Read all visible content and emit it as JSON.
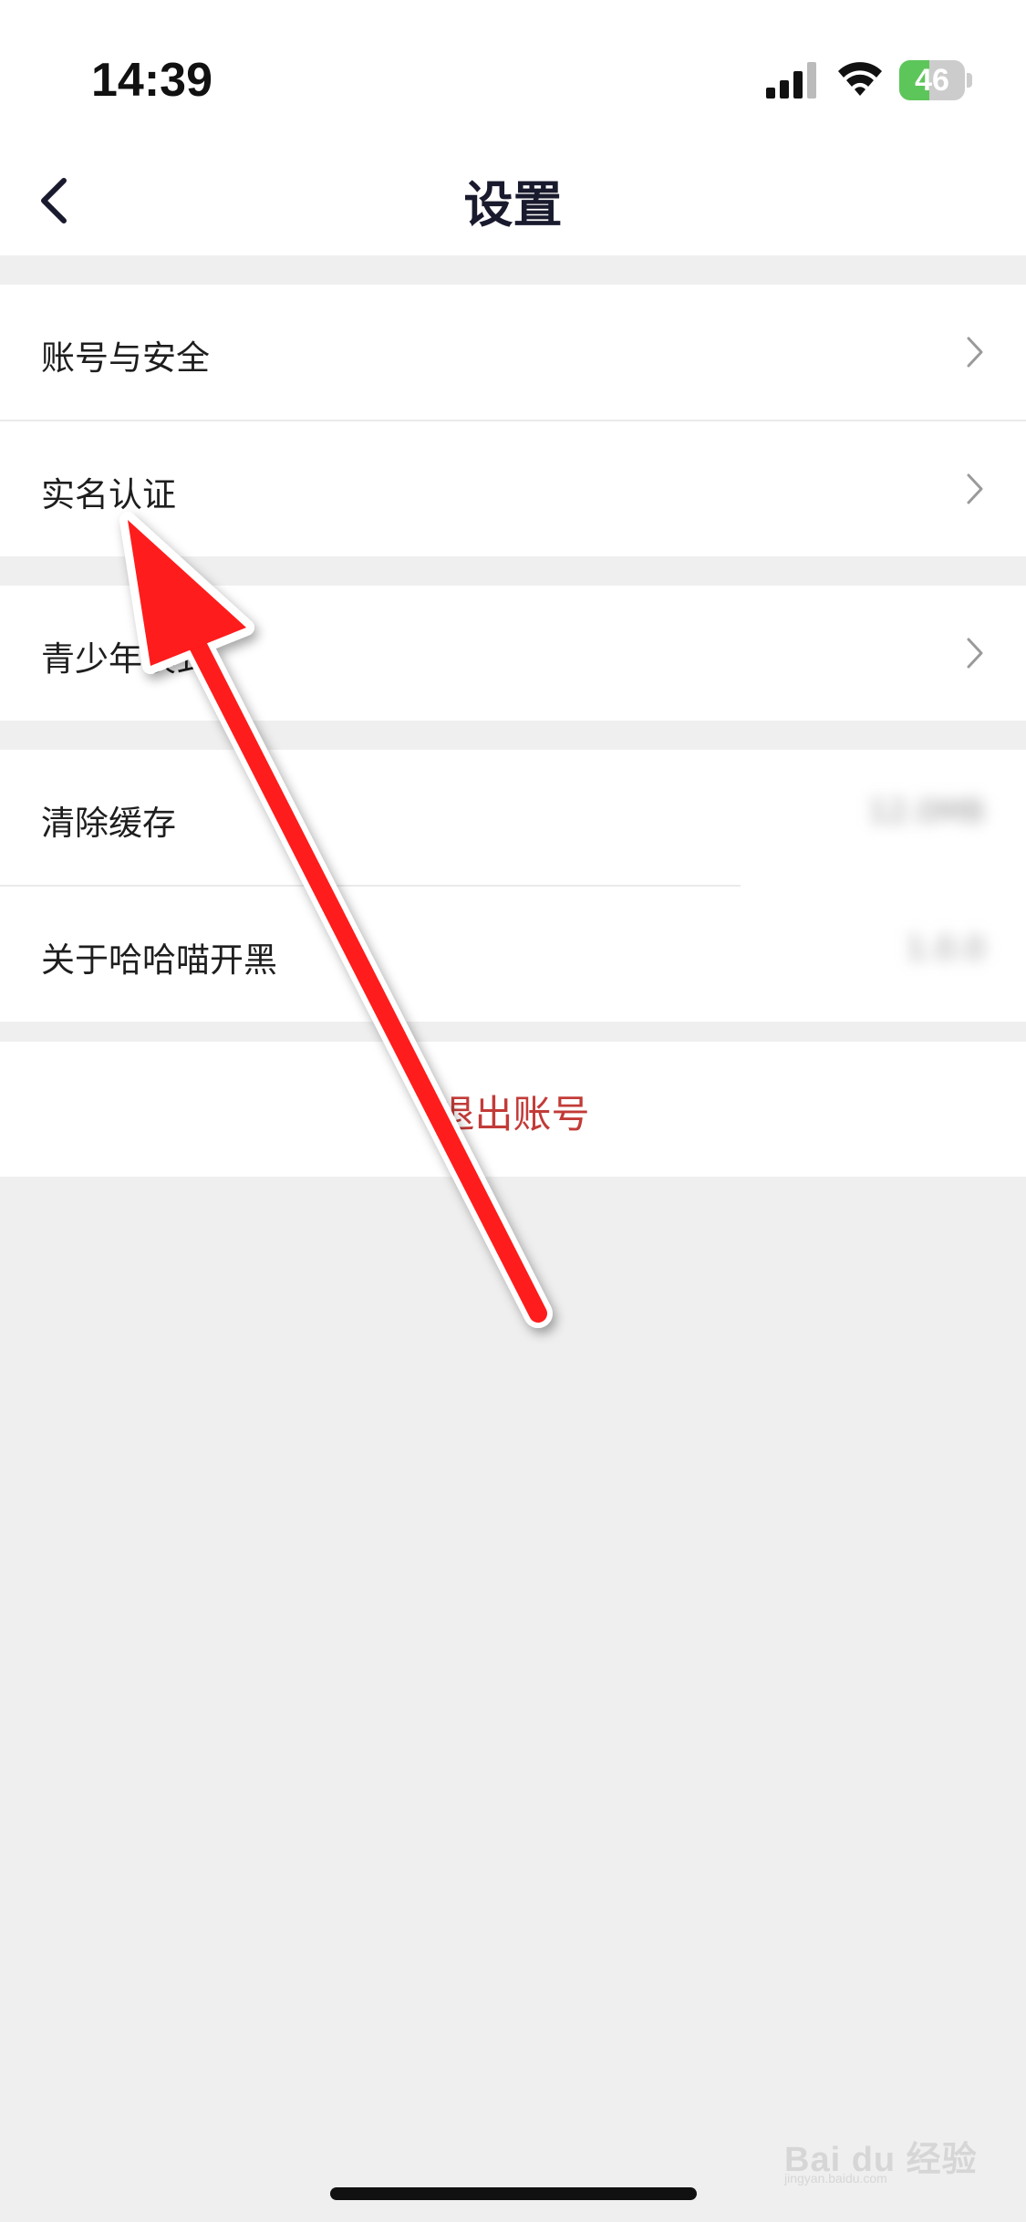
{
  "status_bar": {
    "time": "14:39",
    "battery_level": "46",
    "battery_fraction": 0.46
  },
  "header": {
    "title": "设置"
  },
  "groups": [
    {
      "items": [
        {
          "label": "账号与安全"
        },
        {
          "label": "实名认证"
        }
      ]
    },
    {
      "items": [
        {
          "label": "青少年模式"
        }
      ]
    },
    {
      "items": [
        {
          "label": "清除缓存",
          "value": "12.0MB"
        },
        {
          "label": "关于哈哈喵开黑",
          "value": "1.0.0"
        }
      ]
    }
  ],
  "logout": {
    "label": "退出账号"
  },
  "annotation": {
    "arrow_color": "#ff1a1a"
  },
  "watermark": {
    "text": "Bai du 经验",
    "sub": "jingyan.baidu.com"
  },
  "colors": {
    "background": "#efefef",
    "accent_red": "#c23b38",
    "title": "#1a1a2e"
  }
}
